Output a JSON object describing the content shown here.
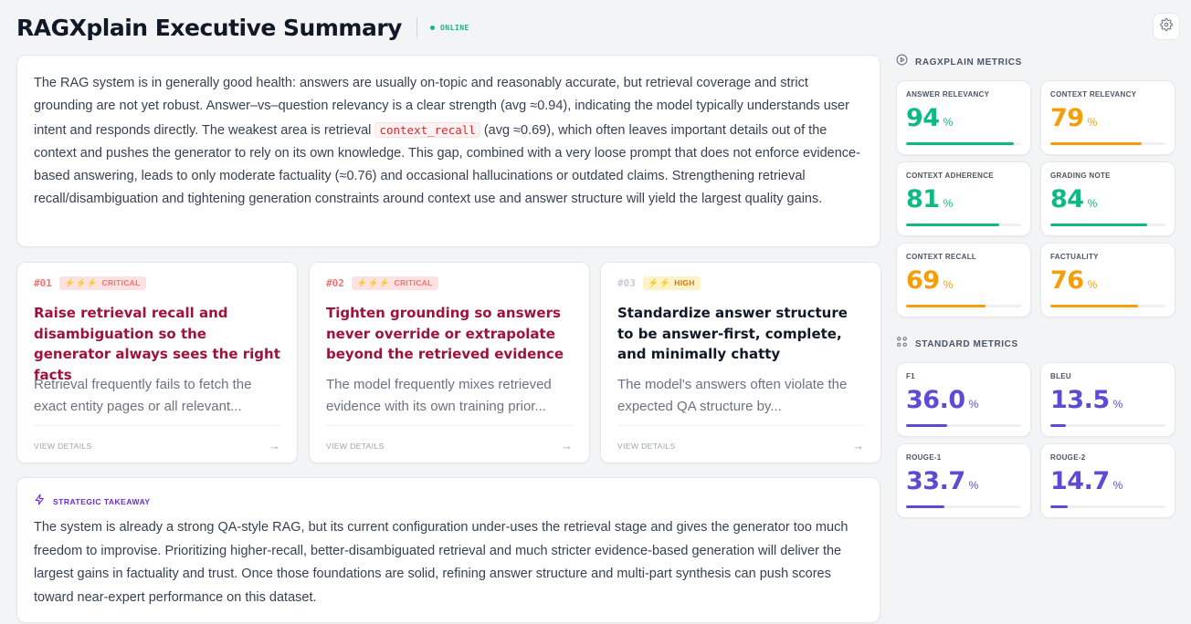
{
  "header": {
    "title": "RAGXplain Executive Summary",
    "status": "ONLINE",
    "status_color": "#10b981"
  },
  "summary": {
    "text_before": "The RAG system is in generally good health: answers are usually on-topic and reasonably accurate, but retrieval coverage and strict grounding are not yet robust. Answer–vs–question relevancy is a clear strength (avg ≈0.94), indicating the model typically understands user intent and responds directly. The weakest area is retrieval ",
    "code": "context_recall",
    "text_after": " (avg ≈0.69), which often leaves important details out of the context and pushes the generator to rely on its own knowledge. This gap, combined with a very loose prompt that does not enforce evidence-based answering, leads to only moderate factuality (≈0.76) and occasional hallucinations or outdated claims. Strengthening retrieval recall/disambiguation and tightening generation constraints around context use and answer structure will yield the largest quality gains."
  },
  "recommendations": [
    {
      "num": "#01",
      "bolts": "⚡⚡⚡",
      "priority": "CRITICAL",
      "title": "Raise retrieval recall and disambiguation so the generator always sees the right facts",
      "desc": "Retrieval frequently fails to fetch the exact entity pages or all relevant...",
      "footer": "VIEW DETAILS",
      "arrow": "→"
    },
    {
      "num": "#02",
      "bolts": "⚡⚡⚡",
      "priority": "CRITICAL",
      "title": "Tighten grounding so answers never override or extrapolate beyond the retrieved evidence",
      "desc": "The model frequently mixes retrieved evidence with its own training prior...",
      "footer": "VIEW DETAILS",
      "arrow": "→"
    },
    {
      "num": "#03",
      "bolts": "⚡⚡",
      "priority": "HIGH",
      "title": "Standardize answer structure to be answer-first, complete, and minimally chatty",
      "desc": "The model's answers often violate the expected QA structure by...",
      "footer": "VIEW DETAILS",
      "arrow": "→"
    }
  ],
  "takeaway": {
    "label": "STRATEGIC TAKEAWAY",
    "text": "The system is already a strong QA-style RAG, but its current configuration under-uses the retrieval stage and gives the generator too much freedom to improvise. Prioritizing higher-recall, better-disambiguated retrieval and much stricter evidence-based generation will deliver the largest gains in factuality and trust. Once those foundations are solid, refining answer structure and multi-part synthesis can push scores toward near-expert performance on this dataset."
  },
  "ragxplain_metrics": {
    "label": "RAGXPLAIN METRICS",
    "items": [
      {
        "label": "ANSWER RELEVANCY",
        "value": "94",
        "unit": "%",
        "fraction": 0.94,
        "color": "#10b981"
      },
      {
        "label": "CONTEXT RELEVANCY",
        "value": "79",
        "unit": "%",
        "fraction": 0.79,
        "color": "#f59e0b"
      },
      {
        "label": "CONTEXT ADHERENCE",
        "value": "81",
        "unit": "%",
        "fraction": 0.81,
        "color": "#10b981"
      },
      {
        "label": "GRADING NOTE",
        "value": "84",
        "unit": "%",
        "fraction": 0.84,
        "color": "#10b981"
      },
      {
        "label": "CONTEXT RECALL",
        "value": "69",
        "unit": "%",
        "fraction": 0.69,
        "color": "#f59e0b"
      },
      {
        "label": "FACTUALITY",
        "value": "76",
        "unit": "%",
        "fraction": 0.76,
        "color": "#f59e0b"
      }
    ]
  },
  "standard_metrics": {
    "label": "STANDARD METRICS",
    "items": [
      {
        "label": "F1",
        "value": "36.0",
        "unit": "%",
        "fraction": 0.36,
        "color": "#5b4bd6"
      },
      {
        "label": "BLEU",
        "value": "13.5",
        "unit": "%",
        "fraction": 0.135,
        "color": "#5b4bd6"
      },
      {
        "label": "ROUGE-1",
        "value": "33.7",
        "unit": "%",
        "fraction": 0.337,
        "color": "#5b4bd6"
      },
      {
        "label": "ROUGE-2",
        "value": "14.7",
        "unit": "%",
        "fraction": 0.147,
        "color": "#5b4bd6"
      }
    ]
  },
  "colors": {
    "critical_text": "#f87171",
    "critical_bg": "#fee2e2",
    "critical_title": "#9f1239",
    "high_text": "#d97706",
    "high_bg": "#fef3c7",
    "high_num": "#c7cbd3",
    "accent_purple": "#6d28d9"
  }
}
